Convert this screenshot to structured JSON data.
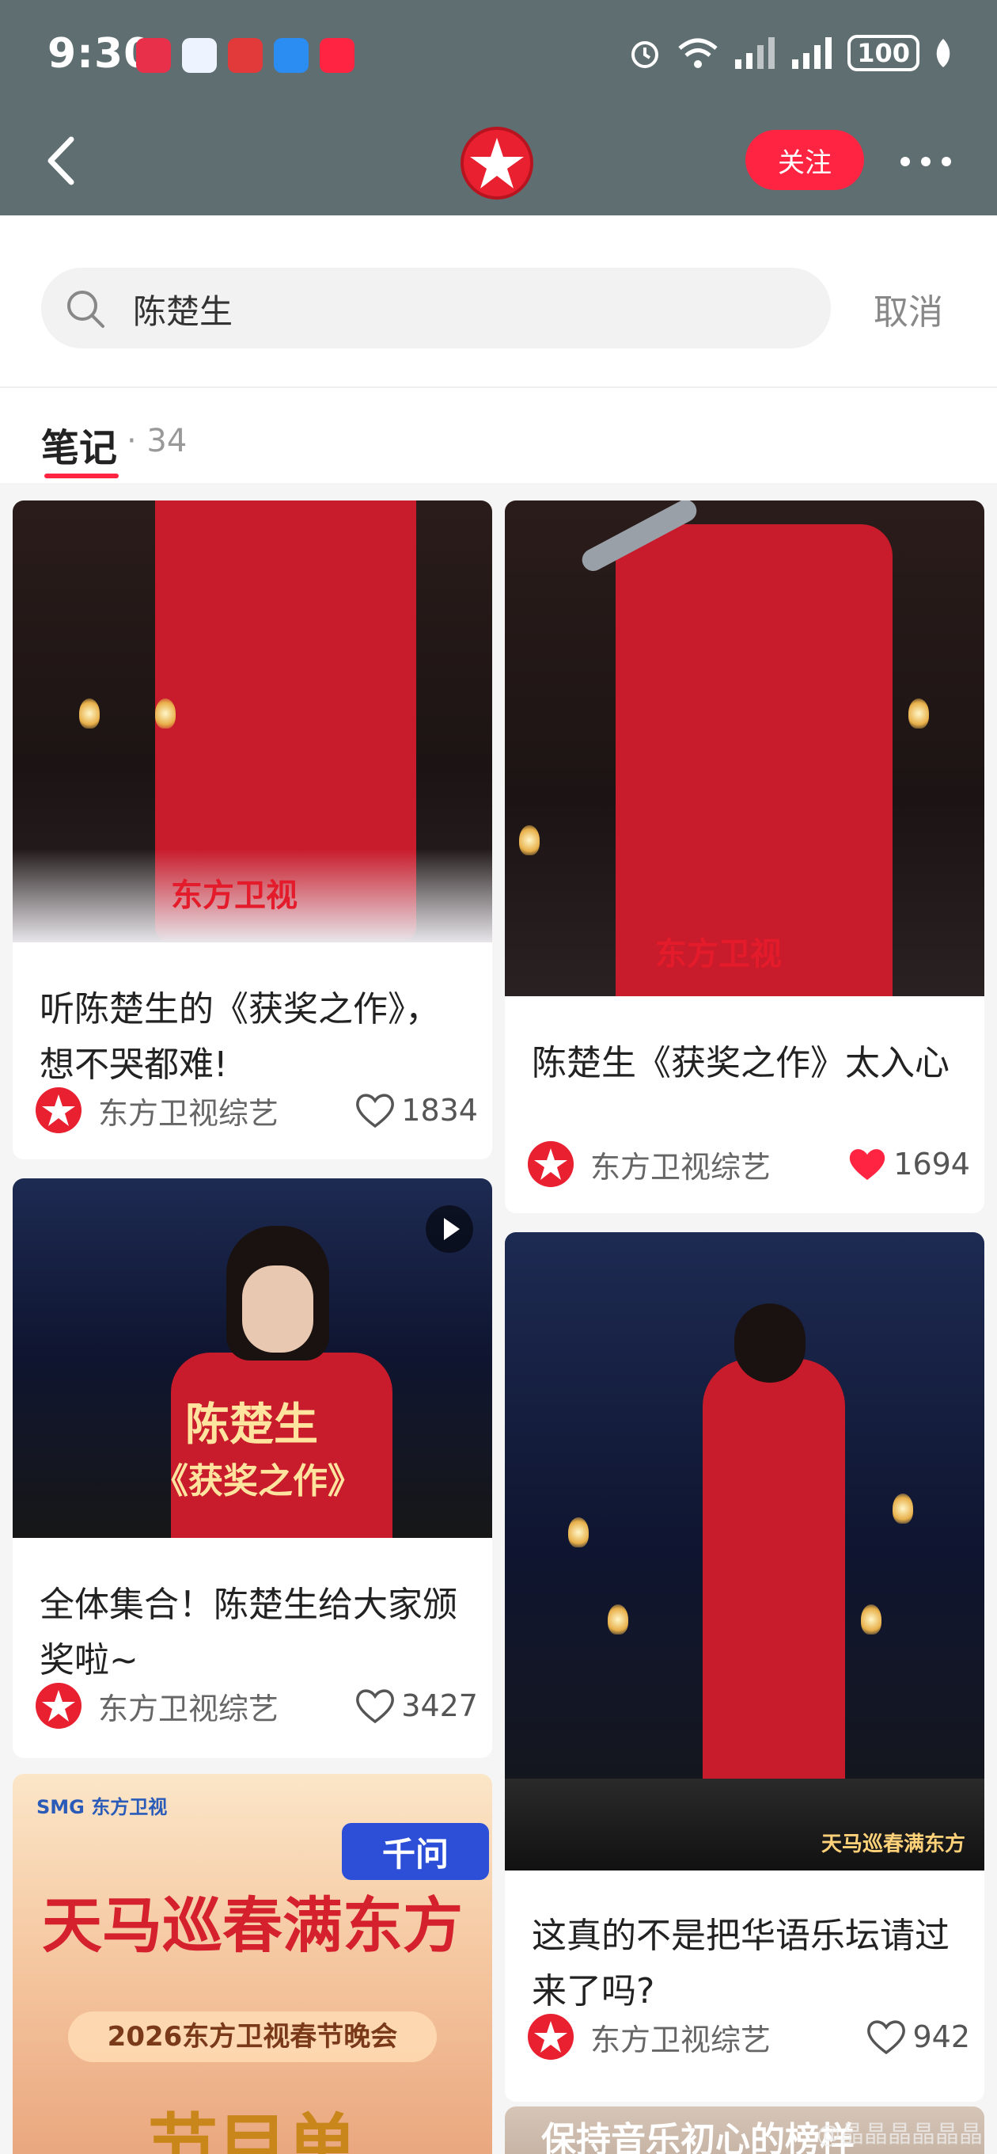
{
  "status_bar": {
    "time": "9:30",
    "battery": "100",
    "app_icons": [
      "app-icon-1",
      "app-icon-2",
      "app-icon-3",
      "app-icon-4",
      "app-icon-5"
    ]
  },
  "nav": {
    "follow_label": "关注"
  },
  "search": {
    "query": "陈楚生",
    "cancel_label": "取消"
  },
  "tabs": {
    "label": "笔记",
    "count": "· 34"
  },
  "colors": {
    "accent": "#ff2442",
    "header_bg": "#5f6e70",
    "feed_bg": "#f5f5f5"
  },
  "cards": [
    {
      "title": "听陈楚生的《获奖之作》，想不哭都难!",
      "author": "东方卫视综艺",
      "likes": "1834",
      "liked": false,
      "image_caption": "东方卫视"
    },
    {
      "title": "陈楚生《获奖之作》太入心",
      "author": "东方卫视综艺",
      "likes": "1694",
      "liked": true,
      "image_caption": "东方卫视"
    },
    {
      "title": "全体集合！陈楚生给大家颁奖啦~",
      "author": "东方卫视综艺",
      "likes": "3427",
      "liked": false,
      "image_text_1": "陈楚生",
      "image_text_2": "《获奖之作》"
    },
    {
      "title": "这真的不是把华语乐坛请过来了吗?",
      "author": "东方卫视综艺",
      "likes": "942",
      "liked": false,
      "image_caption": "天马巡春满东方"
    },
    {
      "image_top_left": "SMG 东方卫视",
      "image_badge": "千问",
      "image_headline": "天马巡春满东方",
      "image_sub": "2026东方卫视春节晚会",
      "image_bottom": "节目单"
    },
    {
      "image_text": "保持音乐初心的榜样"
    }
  ],
  "watermark": "@晶晶晶晶晶晶"
}
